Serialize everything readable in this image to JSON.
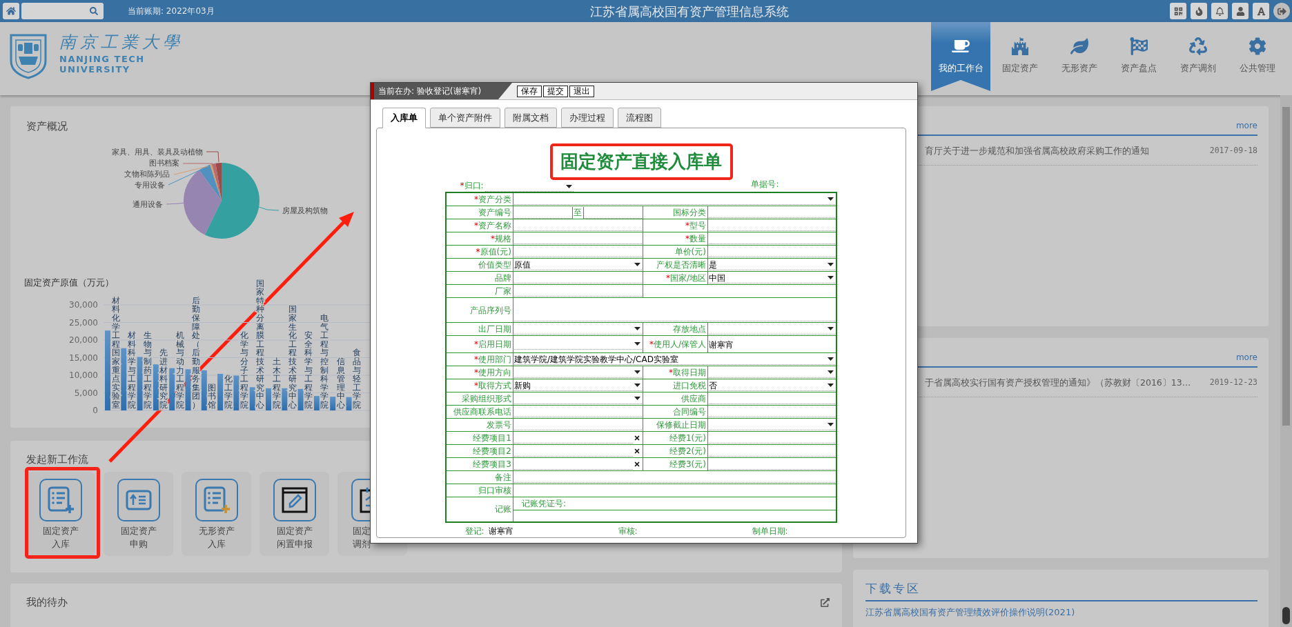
{
  "header": {
    "period": "当前账期: 2022年03月",
    "title": "江苏省属高校国有资产管理信息系统"
  },
  "logo": {
    "name_cn": "南京工業大學",
    "name_en_1": "NANJING TECH",
    "name_en_2": "UNIVERSITY"
  },
  "nav": [
    {
      "label": "我的工作台",
      "selected": true
    },
    {
      "label": "固定资产",
      "selected": false
    },
    {
      "label": "无形资产",
      "selected": false
    },
    {
      "label": "资产盘点",
      "selected": false
    },
    {
      "label": "资产调剂",
      "selected": false
    },
    {
      "label": "公共管理",
      "selected": false
    }
  ],
  "overview": {
    "title": "资产概况",
    "pie": [
      {
        "label": "家具、用具、装具及动植物",
        "color": "#9c4a4a"
      },
      {
        "label": "图书档案",
        "color": "#b86a6e"
      },
      {
        "label": "文物和陈列品",
        "color": "#d2a070"
      },
      {
        "label": "专用设备",
        "color": "#5191bf"
      },
      {
        "label": "通用设备",
        "color": "#9685b1"
      },
      {
        "label": "房屋及构筑物",
        "color": "#34a1a0"
      }
    ],
    "chart_data": {
      "type": "bar",
      "title": "固定资产原值（万元）",
      "grid": true,
      "categories": [
        "材料化学工程国家重点实验室",
        "材料科学与工程学院",
        "生物与制药工程学院",
        "先进材料研究院",
        "机械与动力工程学院",
        "后勤保障处（后勤服务集团）",
        "图书馆",
        "化工学院",
        "化学与分子工程学院",
        "国家特种分离膜工程技术研究中心",
        "土木工程学院",
        "国家生化工程技术研究中心",
        "安全科学与工程学院",
        "电气工程与控制科学学院",
        "信息管理中心",
        "食品与轻工学院"
      ],
      "values": [
        22700,
        17700,
        15200,
        13100,
        12000,
        11700,
        11400,
        10400,
        9900,
        6600,
        6300,
        6300,
        6100,
        4100,
        3900,
        3800
      ],
      "ylim": [
        0,
        30000
      ],
      "yticks": [
        {
          "value": 0,
          "label": "0"
        },
        {
          "value": 5000,
          "label": "5,000"
        },
        {
          "value": 10000,
          "label": "10,000"
        },
        {
          "value": 15000,
          "label": "15,000"
        },
        {
          "value": 20000,
          "label": "20,000"
        },
        {
          "value": 25000,
          "label": "25,000"
        },
        {
          "value": 30000,
          "label": "30,000"
        }
      ]
    }
  },
  "workflow": {
    "title": "发起新工作流",
    "tiles": [
      {
        "lines": [
          "固定资产",
          "入库"
        ],
        "highlighted": true,
        "partial": false
      },
      {
        "lines": [
          "固定资产",
          "申购"
        ],
        "highlighted": false,
        "partial": false
      },
      {
        "lines": [
          "无形资产",
          "入库"
        ],
        "highlighted": false,
        "partial": false
      },
      {
        "lines": [
          "固定资产",
          "闲置申报"
        ],
        "highlighted": false,
        "partial": false
      },
      {
        "lines": [
          "固定",
          "调剂"
        ],
        "highlighted": false,
        "partial": true
      }
    ]
  },
  "todo": {
    "title": "我的待办"
  },
  "notices": [
    {
      "more": "more",
      "items": [
        {
          "title": "育厅关于进一步规范和加强省属高校政府采购工作的通知",
          "date": "2017-09-18"
        }
      ]
    },
    {
      "more": "more",
      "items": [
        {
          "title": "于省属高校实行国有资产授权管理的通知》（苏教财〔2016〕13…",
          "date": "2019-12-23"
        }
      ]
    }
  ],
  "downloads": {
    "title": "下载专区",
    "links": [
      "江苏省属高校国有资产管理绩效评价操作说明(2021)"
    ]
  },
  "dialog": {
    "current": "当前在办: 验收登记(谢寒宵)",
    "buttons": [
      "保存",
      "提交",
      "退出"
    ],
    "tabs": [
      {
        "label": "入库单",
        "selected": true
      },
      {
        "label": "单个资产附件",
        "selected": false
      },
      {
        "label": "附属文档",
        "selected": false
      },
      {
        "label": "办理过程",
        "selected": false
      },
      {
        "label": "流程图",
        "selected": false
      }
    ],
    "form": {
      "title": "固定资产直接入库单",
      "highlighted": true,
      "dept": {
        "mark": "*",
        "label": "归口:"
      },
      "doc_no_label": "单据号:",
      "rows": [
        {
          "fields": [
            {
              "mark": "*",
              "label": "资产分类",
              "kind": "select"
            }
          ]
        },
        {
          "fields": [
            {
              "label": "资产编号",
              "kind": "range",
              "separator": "至"
            },
            {
              "label": "国标分类",
              "kind": "input"
            }
          ]
        },
        {
          "fields": [
            {
              "mark": "*",
              "label": "资产名称",
              "kind": "input"
            },
            {
              "mark": "*",
              "label": "型号",
              "kind": "input"
            }
          ]
        },
        {
          "fields": [
            {
              "mark": "*",
              "label": "规格",
              "kind": "input"
            },
            {
              "mark": "*",
              "label": "数量",
              "kind": "input"
            }
          ]
        },
        {
          "fields": [
            {
              "mark": "*",
              "label": "原值(元)",
              "kind": "input"
            },
            {
              "label": "单价(元)",
              "kind": "input"
            }
          ]
        },
        {
          "fields": [
            {
              "label": "价值类型",
              "kind": "select",
              "value": "原值"
            },
            {
              "label": "产权是否清晰",
              "kind": "select",
              "value": "是"
            }
          ]
        },
        {
          "fields": [
            {
              "label": "品牌",
              "kind": "input"
            },
            {
              "mark": "*",
              "label": "国家/地区",
              "kind": "select",
              "value": "中国"
            }
          ]
        },
        {
          "fields": [
            {
              "label": "厂家",
              "kind": "input"
            },
            {
              "kind": "blank"
            }
          ]
        },
        {
          "fields": [
            {
              "label": "产品序列号",
              "kind": "textarea"
            }
          ]
        },
        {
          "fields": [
            {
              "label": "出厂日期",
              "kind": "select"
            },
            {
              "label": "存放地点",
              "kind": "select"
            }
          ]
        },
        {
          "fields": [
            {
              "mark": "*",
              "label": "启用日期",
              "kind": "select"
            },
            {
              "mark": "*",
              "label": "使用人/保管人",
              "kind": "text",
              "value": "谢寒宵"
            }
          ]
        },
        {
          "fields": [
            {
              "mark": "*",
              "label": "使用部门",
              "kind": "select",
              "value": "建筑学院/建筑学院实验教学中心/CAD实验室"
            }
          ]
        },
        {
          "fields": [
            {
              "mark": "*",
              "label": "使用方向",
              "kind": "select"
            },
            {
              "mark": "*",
              "label": "取得日期",
              "kind": "select"
            }
          ]
        },
        {
          "fields": [
            {
              "mark": "*",
              "label": "取得方式",
              "kind": "select",
              "value": "新购"
            },
            {
              "label": "进口免税",
              "kind": "select",
              "value": "否"
            }
          ]
        },
        {
          "fields": [
            {
              "label": "采购组织形式",
              "kind": "select"
            },
            {
              "label": "供应商",
              "kind": "input"
            }
          ]
        },
        {
          "fields": [
            {
              "label": "供应商联系电话",
              "kind": "input"
            },
            {
              "label": "合同编号",
              "kind": "input"
            }
          ]
        },
        {
          "fields": [
            {
              "label": "发票号",
              "kind": "input"
            },
            {
              "label": "保修截止日期",
              "kind": "select"
            }
          ]
        },
        {
          "fields": [
            {
              "label": "经费项目1",
              "kind": "clearable"
            },
            {
              "label": "经费1(元)",
              "kind": "input"
            }
          ]
        },
        {
          "fields": [
            {
              "label": "经费项目2",
              "kind": "clearable"
            },
            {
              "label": "经费2(元)",
              "kind": "input"
            }
          ]
        },
        {
          "fields": [
            {
              "label": "经费项目3",
              "kind": "clearable"
            },
            {
              "label": "经费3(元)",
              "kind": "input"
            }
          ]
        },
        {
          "fields": [
            {
              "label": "备注",
              "kind": "input"
            }
          ]
        },
        {
          "fields": [
            {
              "label": "归口审核",
              "kind": "blank"
            }
          ]
        },
        {
          "fields": [
            {
              "label": "记账",
              "kind": "ledger",
              "voucher_label": "记账凭证号:"
            }
          ]
        }
      ],
      "footer": [
        {
          "label": "登记:",
          "value": "谢寒宵"
        },
        {
          "label": "审核:"
        },
        {
          "label": "制单日期:"
        }
      ]
    }
  }
}
